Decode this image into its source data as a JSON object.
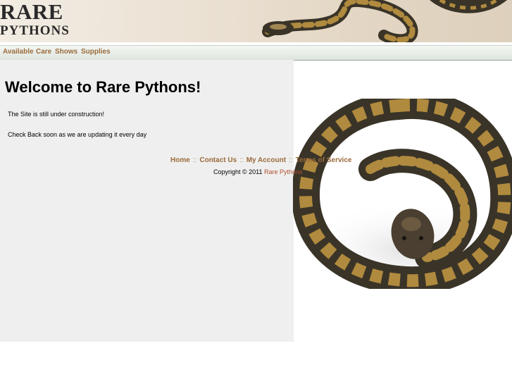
{
  "header": {
    "logo_line1": "RARE",
    "logo_line2": "PYTHONS"
  },
  "nav": {
    "items": [
      "Available",
      "Care",
      "Shows",
      "Supplies"
    ]
  },
  "main": {
    "title": "Welcome to Rare Pythons!",
    "paragraph1": "The Site is still under construction!",
    "paragraph2": "Check Back soon as we are updating it every day"
  },
  "footer": {
    "links": [
      "Home",
      "Contact Us",
      "My Account",
      "Terms of Service"
    ],
    "separator": "::",
    "copyright_prefix": "Copyright © 2011",
    "copyright_link": "Rare Pythons"
  },
  "colors": {
    "link": "#9a6b3a",
    "content_bg": "#efefef",
    "snake_tan": "#b08a3e",
    "snake_dark": "#3a3428"
  }
}
